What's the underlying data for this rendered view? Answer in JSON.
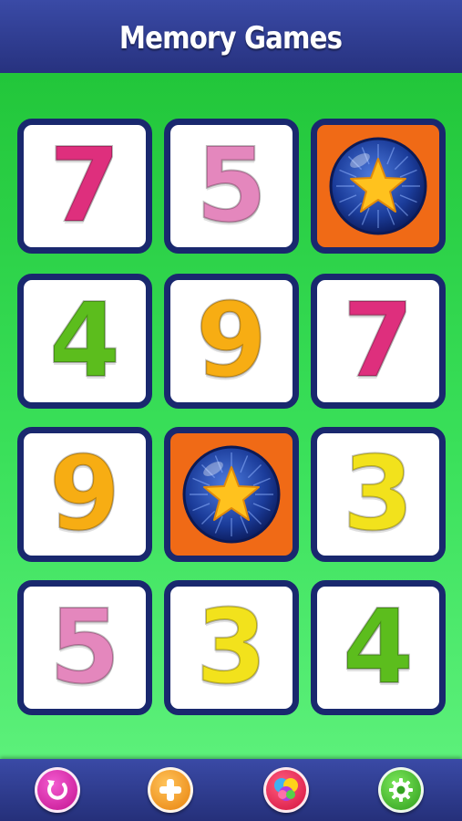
{
  "header": {
    "title": "Memory Games"
  },
  "colors": {
    "header_bg": "#2e3c92",
    "board_green": "#22c63a",
    "card_border": "#19286e",
    "card_back": "#f06a16",
    "orb_blue": "#1b3c9a",
    "star": "#ffc21e"
  },
  "cards": [
    {
      "face": "7",
      "color": "magenta",
      "state": "revealed"
    },
    {
      "face": "5",
      "color": "pink",
      "state": "revealed"
    },
    {
      "face": "star",
      "color": "orange",
      "state": "hidden"
    },
    {
      "face": "4",
      "color": "green",
      "state": "revealed"
    },
    {
      "face": "9",
      "color": "orange",
      "state": "revealed"
    },
    {
      "face": "7",
      "color": "magenta",
      "state": "revealed"
    },
    {
      "face": "9",
      "color": "orange",
      "state": "revealed"
    },
    {
      "face": "star",
      "color": "orange",
      "state": "hidden"
    },
    {
      "face": "3",
      "color": "yellow",
      "state": "revealed"
    },
    {
      "face": "5",
      "color": "pink",
      "state": "revealed"
    },
    {
      "face": "3",
      "color": "yellow",
      "state": "revealed"
    },
    {
      "face": "4",
      "color": "green",
      "state": "revealed"
    }
  ],
  "footer": {
    "buttons": [
      {
        "icon": "restart-icon",
        "color": "#d81ea6"
      },
      {
        "icon": "plus-icon",
        "color": "#f29a1c"
      },
      {
        "icon": "color-balls-icon",
        "color": "#e8245a"
      },
      {
        "icon": "gear-icon",
        "color": "#43b52a"
      }
    ]
  }
}
